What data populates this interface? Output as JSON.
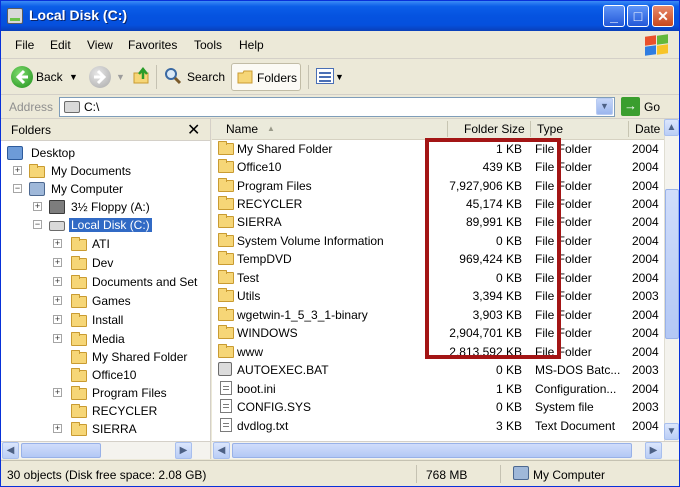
{
  "window": {
    "title": "Local Disk (C:)"
  },
  "menu": [
    "File",
    "Edit",
    "View",
    "Favorites",
    "Tools",
    "Help"
  ],
  "toolbar": {
    "back_label": "Back",
    "search_label": "Search",
    "folders_label": "Folders"
  },
  "address": {
    "label": "Address",
    "value": "C:\\",
    "go_label": "Go"
  },
  "folders_pane": {
    "title": "Folders",
    "tree": [
      {
        "label": "Desktop",
        "icon": "desktop-icon"
      },
      {
        "label": "My Documents",
        "icon": "documents-icon"
      },
      {
        "label": "My Computer",
        "icon": "computer-icon"
      },
      {
        "label": "3½ Floppy (A:)",
        "icon": "floppy-icon"
      },
      {
        "label": "Local Disk (C:)",
        "icon": "disk-icon",
        "selected": true
      },
      {
        "label": "ATI",
        "icon": "folder-icon"
      },
      {
        "label": "Dev",
        "icon": "folder-icon"
      },
      {
        "label": "Documents and Set",
        "icon": "folder-icon"
      },
      {
        "label": "Games",
        "icon": "folder-icon"
      },
      {
        "label": "Install",
        "icon": "folder-icon"
      },
      {
        "label": "Media",
        "icon": "folder-icon"
      },
      {
        "label": "My Shared Folder",
        "icon": "folder-icon"
      },
      {
        "label": "Office10",
        "icon": "folder-icon"
      },
      {
        "label": "Program Files",
        "icon": "folder-icon"
      },
      {
        "label": "RECYCLER",
        "icon": "folder-icon"
      },
      {
        "label": "SIERRA",
        "icon": "folder-icon"
      }
    ]
  },
  "columns": {
    "name": "Name",
    "size": "Folder Size",
    "type": "Type",
    "date": "Date"
  },
  "files": [
    {
      "name": "My Shared Folder",
      "size": "1 KB",
      "type": "File Folder",
      "date": "2004",
      "icon": "folder-icon"
    },
    {
      "name": "Office10",
      "size": "439 KB",
      "type": "File Folder",
      "date": "2004",
      "icon": "folder-icon"
    },
    {
      "name": "Program Files",
      "size": "7,927,906 KB",
      "type": "File Folder",
      "date": "2004",
      "icon": "folder-icon"
    },
    {
      "name": "RECYCLER",
      "size": "45,174 KB",
      "type": "File Folder",
      "date": "2004",
      "icon": "folder-icon"
    },
    {
      "name": "SIERRA",
      "size": "89,991 KB",
      "type": "File Folder",
      "date": "2004",
      "icon": "folder-icon"
    },
    {
      "name": "System Volume Information",
      "size": "0 KB",
      "type": "File Folder",
      "date": "2004",
      "icon": "folder-icon"
    },
    {
      "name": "TempDVD",
      "size": "969,424 KB",
      "type": "File Folder",
      "date": "2004",
      "icon": "folder-icon"
    },
    {
      "name": "Test",
      "size": "0 KB",
      "type": "File Folder",
      "date": "2004",
      "icon": "folder-icon"
    },
    {
      "name": "Utils",
      "size": "3,394 KB",
      "type": "File Folder",
      "date": "2003",
      "icon": "folder-icon"
    },
    {
      "name": "wgetwin-1_5_3_1-binary",
      "size": "3,903 KB",
      "type": "File Folder",
      "date": "2004",
      "icon": "folder-icon"
    },
    {
      "name": "WINDOWS",
      "size": "2,904,701 KB",
      "type": "File Folder",
      "date": "2004",
      "icon": "folder-icon"
    },
    {
      "name": "www",
      "size": "2,813,592 KB",
      "type": "File Folder",
      "date": "2004",
      "icon": "folder-icon"
    },
    {
      "name": "AUTOEXEC.BAT",
      "size": "0 KB",
      "type": "MS-DOS Batc...",
      "date": "2003",
      "icon": "batch-file-icon"
    },
    {
      "name": "boot.ini",
      "size": "1 KB",
      "type": "Configuration...",
      "date": "2004",
      "icon": "settings-file-icon"
    },
    {
      "name": "CONFIG.SYS",
      "size": "0 KB",
      "type": "System file",
      "date": "2003",
      "icon": "text-file-icon"
    },
    {
      "name": "dvdlog.txt",
      "size": "3 KB",
      "type": "Text Document",
      "date": "2004",
      "icon": "text-file-icon"
    }
  ],
  "status": {
    "objects": "30 objects (Disk free space: 2.08 GB)",
    "size": "768 MB",
    "location": "My Computer"
  },
  "colors": {
    "title_bar": "#0553e0",
    "highlight_box": "#a31515",
    "selection": "#316ac5",
    "folder": "#f6d677"
  }
}
